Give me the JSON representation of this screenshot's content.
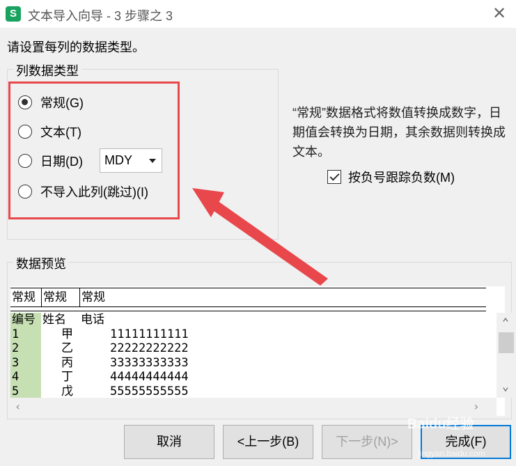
{
  "window": {
    "app_icon": "S",
    "title": "文本导入向导 - 3 步骤之 3",
    "close_glyph": "✕"
  },
  "instruction": "请设置每列的数据类型。",
  "column_type": {
    "group_title": "列数据类型",
    "options": [
      {
        "label": "常规(G)",
        "checked": true
      },
      {
        "label": "文本(T)",
        "checked": false
      },
      {
        "label": "日期(D)",
        "checked": false
      },
      {
        "label": "不导入此列(跳过)(I)",
        "checked": false
      }
    ],
    "date_format_selected": "MDY"
  },
  "description": "“常规”数据格式将数值转换成数字，日期值会转换为日期，其余数据则转换成文本。",
  "negative_checkbox": {
    "label": "按负号跟踪负数(M)",
    "checked": true
  },
  "preview": {
    "group_title": "数据预览",
    "headers": [
      "常规",
      "常规",
      "常规"
    ],
    "rows": [
      [
        "编号",
        "姓名",
        "电话"
      ],
      [
        "1",
        "甲",
        "11111111111"
      ],
      [
        "2",
        "乙",
        "22222222222"
      ],
      [
        "3",
        "丙",
        "33333333333"
      ],
      [
        "4",
        "丁",
        "44444444444"
      ],
      [
        "5",
        "戊",
        "55555555555"
      ]
    ],
    "highlight_color": "#c6e0b4"
  },
  "buttons": {
    "cancel": "取消",
    "back": "<上一步(B)",
    "next": "下一步(N)>",
    "finish": "完成(F)"
  },
  "annotation": {
    "color": "#e8474b"
  },
  "watermark": {
    "text": "Baidu经验",
    "sub": "jingyan.baidu.com"
  },
  "icons": {
    "scroll_up": "⌃",
    "scroll_down": "⌄",
    "scroll_left": "‹",
    "scroll_right": "›"
  }
}
